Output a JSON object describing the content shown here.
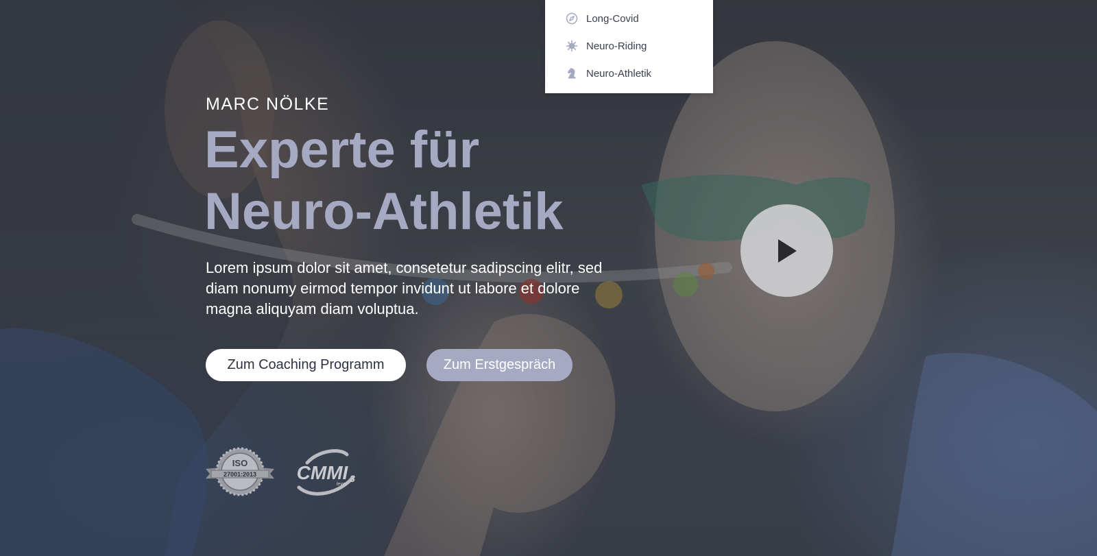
{
  "menu": {
    "items": [
      {
        "label": "Long-Covid",
        "icon": "compass-icon"
      },
      {
        "label": "Neuro-Riding",
        "icon": "virus-icon"
      },
      {
        "label": "Neuro-Athletik",
        "icon": "horse-chess-icon"
      }
    ]
  },
  "hero": {
    "eyebrow": "MARC NÖLKE",
    "headline_line1": "Experte für",
    "headline_line2": "Neuro-Athletik",
    "lead": "Lorem ipsum dolor sit amet, consetetur sadipscing elitr, sed diam nonumy eirmod tempor invidunt ut labore et dolore magna aliquyam diam voluptua.",
    "primary_button": "Zum Coaching Programm",
    "secondary_button": "Zum Erstgespräch",
    "play_icon": "play-icon"
  },
  "badges": {
    "iso": {
      "title": "ISO",
      "code": "27001:2013"
    },
    "cmmi": {
      "title": "CMMI",
      "level_word": "level",
      "level_number": "3"
    }
  },
  "colors": {
    "accent": "#a5a9c2",
    "primary_button_bg": "#ffffff",
    "primary_button_text": "#2d3140",
    "menu_text": "#3a3f4f",
    "menu_icon": "#a5a9c2"
  }
}
